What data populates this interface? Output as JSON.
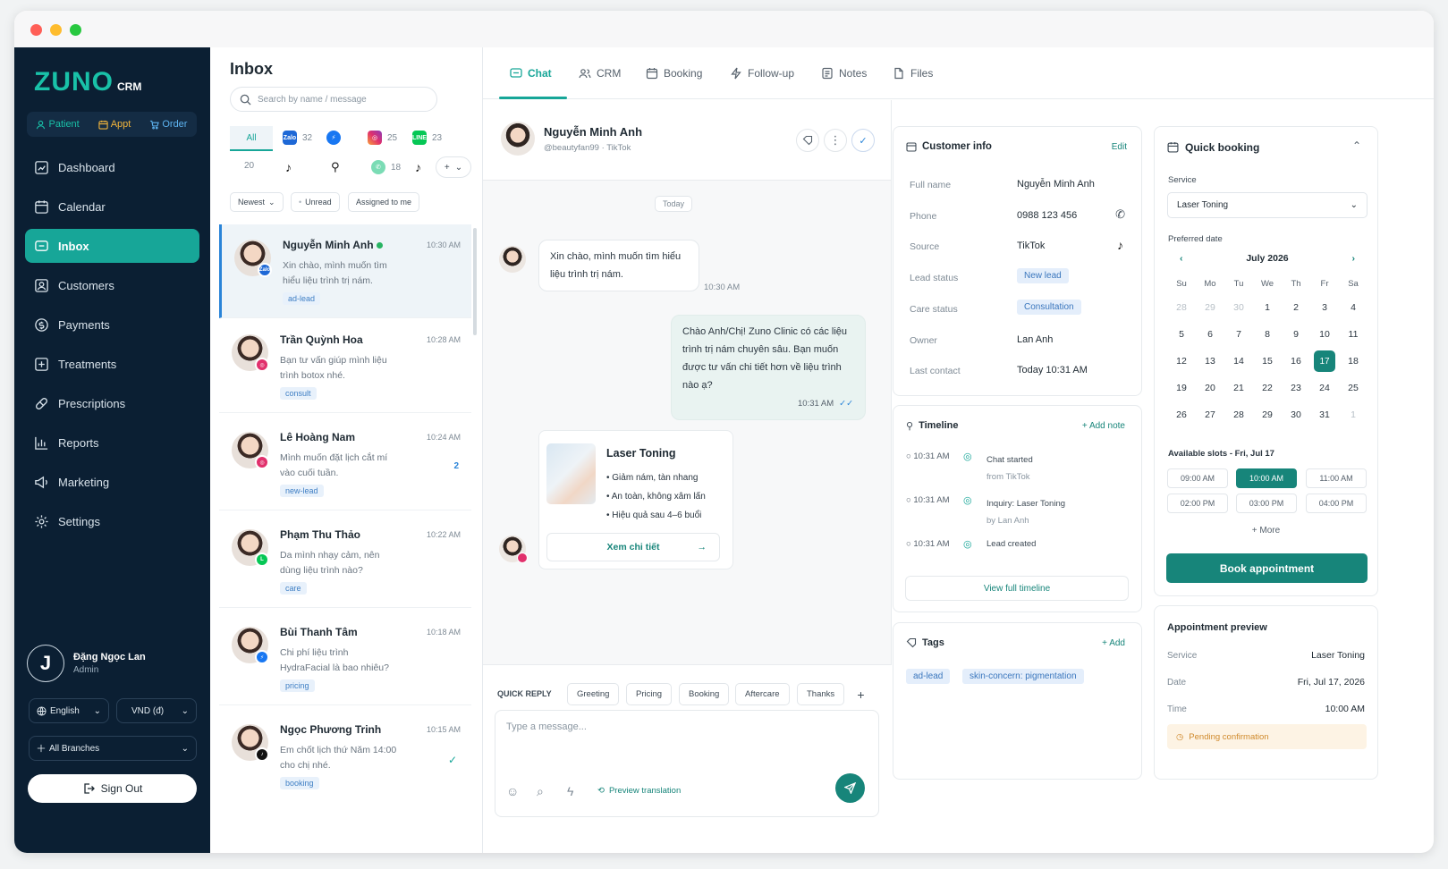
{
  "brand": {
    "name": "ZUNO",
    "suffix": "CRM"
  },
  "quick_actions": [
    {
      "label": "Patient"
    },
    {
      "label": "Appt"
    },
    {
      "label": "Order"
    }
  ],
  "nav": [
    {
      "label": "Dashboard"
    },
    {
      "label": "Calendar"
    },
    {
      "label": "Inbox",
      "active": true
    },
    {
      "label": "Customers"
    },
    {
      "label": "Payments"
    },
    {
      "label": "Treatments"
    },
    {
      "label": "Prescriptions"
    },
    {
      "label": "Reports"
    },
    {
      "label": "Marketing"
    },
    {
      "label": "Settings"
    }
  ],
  "user": {
    "initial": "J",
    "name": "Đặng Ngọc Lan",
    "role": "Admin"
  },
  "language": "English",
  "currency": "VND (đ)",
  "branch": "All Branches",
  "signout": "Sign Out",
  "inbox": {
    "title": "Inbox",
    "search_placeholder": "Search by name / message",
    "channels": {
      "all": "All",
      "zalo": "32",
      "instagram": "25",
      "line": "23",
      "count2": "20",
      "viber": "18",
      "zalo_label": "Zalo",
      "line_label": "LINE"
    },
    "filters": {
      "newest": "Newest",
      "unread": "Unread",
      "assigned": "Assigned to me"
    },
    "conversations": [
      {
        "name": "Nguyễn Minh Anh",
        "time": "10:30 AM",
        "message": "Xin chào, mình muốn tìm hiểu liệu trình trị nám.",
        "tag": "ad-lead",
        "badge_color": "#1e68d6",
        "badge_label": "Zalo"
      },
      {
        "name": "Trần Quỳnh Hoa",
        "time": "10:28 AM",
        "message": "Bạn tư vấn giúp mình liệu trình botox nhé.",
        "tag": "consult",
        "badge_color": "#e1306c"
      },
      {
        "name": "Lê Hoàng Nam",
        "time": "10:24 AM",
        "message": "Mình muốn đặt lịch cắt mí vào cuối tuần.",
        "tag": "new-lead",
        "unread": "2",
        "badge_color": "#e1306c"
      },
      {
        "name": "Phạm Thu Thảo",
        "time": "10:22 AM",
        "message": "Da mình nhạy cảm, nên dùng liệu trình nào?",
        "tag": "care",
        "badge_color": "#06c755"
      },
      {
        "name": "Bùi Thanh Tâm",
        "time": "10:18 AM",
        "message": "Chi phí liệu trình HydraFacial là bao nhiêu?",
        "tag": "pricing",
        "badge_color": "#1877f2"
      },
      {
        "name": "Ngọc Phương Trinh",
        "time": "10:15 AM",
        "message": "Em chốt lịch thứ Năm 14:00 cho chị nhé.",
        "tag": "booking",
        "badge_color": "#111111"
      }
    ]
  },
  "tabs": [
    {
      "label": "Chat"
    },
    {
      "label": "CRM"
    },
    {
      "label": "Booking"
    },
    {
      "label": "Follow-up"
    },
    {
      "label": "Notes"
    },
    {
      "label": "Files"
    }
  ],
  "chat": {
    "name": "Nguyễn Minh Anh",
    "handle": "@beautyfan99",
    "source": "TikTok",
    "day": "Today",
    "in_msg": "Xin chào, mình muốn tìm hiểu liệu trình trị nám.",
    "in_time": "10:30 AM",
    "out_msg": "Chào Anh/Chị! Zuno Clinic có các liệu trình trị nám chuyên sâu. Bạn muốn được tư vấn chi tiết hơn về liệu trình nào ạ?",
    "out_time": "10:31 AM",
    "product": {
      "title": "Laser Toning",
      "b1": "Giảm nám, tàn nhang",
      "b2": "An toàn, không xâm lấn",
      "b3": "Hiệu quả sau 4–6 buổi",
      "cta": "Xem chi tiết"
    },
    "quick_reply_label": "QUICK REPLY",
    "quick_replies": [
      "Greeting",
      "Pricing",
      "Booking",
      "Aftercare",
      "Thanks"
    ],
    "composer_placeholder": "Type a message...",
    "preview_translation": "Preview translation"
  },
  "customer": {
    "title": "Customer info",
    "edit": "Edit",
    "fields": [
      {
        "k": "Full name",
        "v": "Nguyễn Minh Anh"
      },
      {
        "k": "Phone",
        "v": "0988 123 456"
      },
      {
        "k": "Source",
        "v": "TikTok"
      },
      {
        "k": "Lead status",
        "v": "New lead"
      },
      {
        "k": "Care status",
        "v": "Consultation"
      },
      {
        "k": "Owner",
        "v": "Lan Anh"
      },
      {
        "k": "Last contact",
        "v": "Today 10:31 AM"
      }
    ]
  },
  "timeline": {
    "title": "Timeline",
    "add": "Add note",
    "view_all": "View full timeline",
    "items": [
      {
        "time": "10:31 AM",
        "text": "Chat started",
        "sub": "from TikTok"
      },
      {
        "time": "10:31 AM",
        "text": "Inquiry: Laser Toning",
        "sub": "by Lan Anh"
      },
      {
        "time": "10:31 AM",
        "text": "Lead created",
        "sub": ""
      }
    ]
  },
  "tags": {
    "title": "Tags",
    "add": "Add",
    "items": [
      "ad-lead",
      "skin-concern: pigmentation"
    ]
  },
  "booking": {
    "title": "Quick booking",
    "service_label": "Service",
    "service": "Laser Toning",
    "date_label": "Preferred date",
    "month": "July 2026",
    "weekdays": [
      "Su",
      "Mo",
      "Tu",
      "We",
      "Th",
      "Fr",
      "Sa"
    ],
    "weeks": [
      [
        "28",
        "29",
        "30",
        "1",
        "2",
        "3",
        "4"
      ],
      [
        "5",
        "6",
        "7",
        "8",
        "9",
        "10",
        "11"
      ],
      [
        "12",
        "13",
        "14",
        "15",
        "16",
        "17",
        "18"
      ],
      [
        "19",
        "20",
        "21",
        "22",
        "23",
        "24",
        "25"
      ],
      [
        "26",
        "27",
        "28",
        "29",
        "30",
        "31",
        "1"
      ]
    ],
    "selected_day": "17",
    "slots_label": "Available slots - Fri, Jul 17",
    "slots": [
      "09:00 AM",
      "10:00 AM",
      "11:00 AM",
      "02:00 PM",
      "03:00 PM",
      "04:00 PM"
    ],
    "selected_slot": "10:00 AM",
    "more": "+ More",
    "cta": "Book appointment"
  },
  "preview": {
    "title": "Appointment preview",
    "rows": [
      {
        "k": "Service",
        "v": "Laser Toning"
      },
      {
        "k": "Date",
        "v": "Fri, Jul 17, 2026"
      },
      {
        "k": "Time",
        "v": "10:00 AM"
      }
    ],
    "status": "Pending confirmation"
  },
  "colors": {
    "accent": "#17a698",
    "sidebar": "#0b1f33"
  }
}
